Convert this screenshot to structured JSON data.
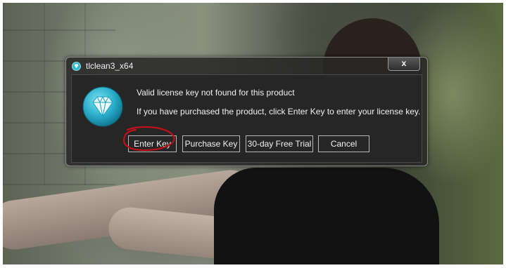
{
  "dialog": {
    "title": "tlclean3_x64",
    "close_label": "x",
    "message_primary": "Valid license key not found for this product",
    "message_secondary": "If you have purchased the product, click Enter Key to enter your license key.",
    "buttons": {
      "enter_key": "Enter Key",
      "purchase_key": "Purchase Key",
      "trial": "30-day Free Trial",
      "cancel": "Cancel"
    }
  },
  "icons": {
    "title": "diamond-icon",
    "app_logo": "diamond-logo-icon",
    "close": "close-icon"
  },
  "colors": {
    "logo_teal": "#2fb8d0",
    "annotation_red": "#c0101a",
    "dialog_bg": "#262626"
  }
}
